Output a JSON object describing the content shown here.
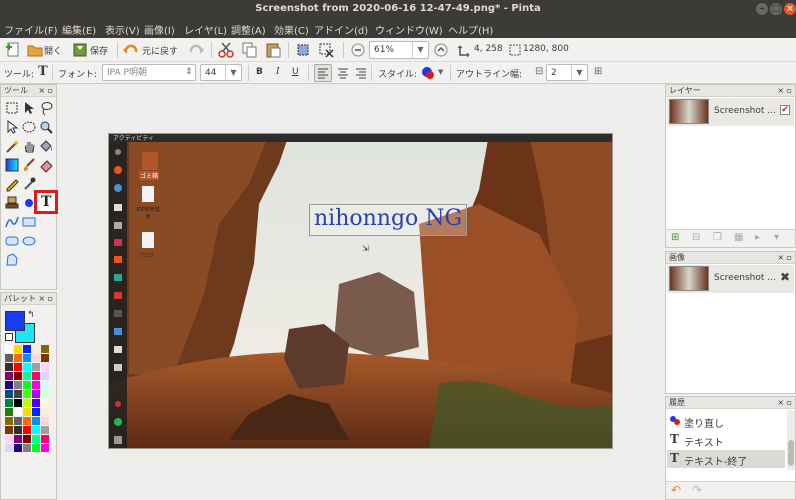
{
  "window": {
    "title": "Screenshot from 2020-06-16 12-47-49.png* - Pinta"
  },
  "menu": [
    "ファイル(F)",
    "編集(E)",
    "表示(V)",
    "画像(I)",
    "レイヤ(L)",
    "調整(A)",
    "効果(C)",
    "アドイン(d)",
    "ウィンドウ(W)",
    "ヘルプ(H)"
  ],
  "toolbar": {
    "open": "開く",
    "save": "保存",
    "undo": "元に戻す",
    "zoom": "61%",
    "cursor_pos": "4, 258",
    "image_size": "1280, 800"
  },
  "textbar": {
    "tool_label": "ツール:",
    "font_label": "フォント:",
    "font": "IPA P明朝",
    "size": "44",
    "bold": "B",
    "italic": "I",
    "underline": "U",
    "style_label": "スタイル:",
    "outline_label": "アウトライン幅:",
    "outline": "2"
  },
  "tools_panel": {
    "title": "ツール"
  },
  "palette_panel": {
    "title": "パレット"
  },
  "layers_panel": {
    "title": "レイヤー",
    "item": "Screenshot ..."
  },
  "images_panel": {
    "title": "画像",
    "item": "Screenshot ..."
  },
  "history_panel": {
    "title": "履歴",
    "items": [
      "塗り直し",
      "テキスト",
      "テキスト-終了"
    ]
  },
  "desktop": {
    "top_left": "アクティビティ",
    "trash": "ゴミ箱",
    "file1": "IDPW管理用",
    "file2": "ブログ"
  },
  "canvas_text": "nihonngo NG",
  "colors": {
    "primary": "#1a3cf0",
    "secondary": "#1ee6f2",
    "accent_red": "#e01b1b",
    "text_blue": "#2a3fb0"
  }
}
